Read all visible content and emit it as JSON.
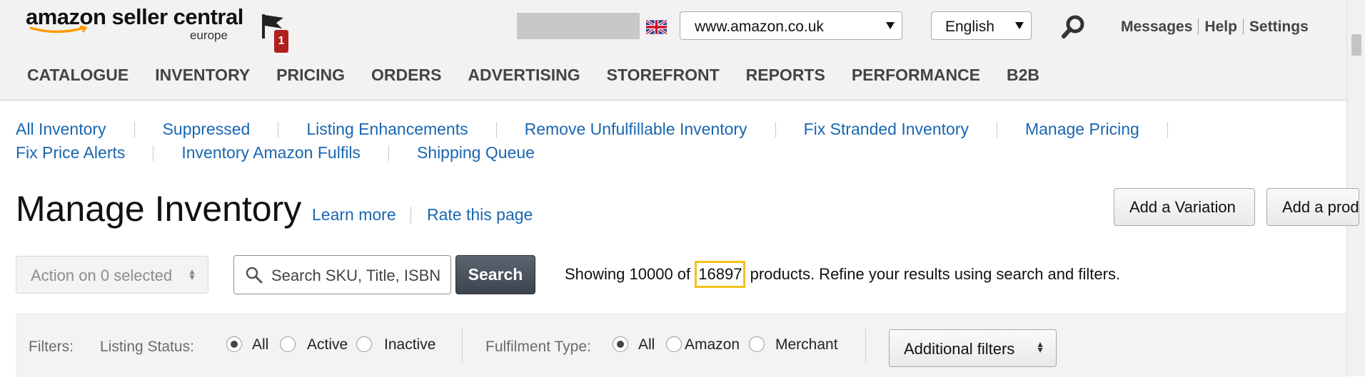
{
  "header": {
    "logo_brand": "amazon seller central",
    "logo_region": "europe",
    "alerts_count": "1",
    "marketplace": "www.amazon.co.uk",
    "language": "English",
    "links": [
      "Messages",
      "Help",
      "Settings"
    ]
  },
  "main_nav": [
    "CATALOGUE",
    "INVENTORY",
    "PRICING",
    "ORDERS",
    "ADVERTISING",
    "STOREFRONT",
    "REPORTS",
    "PERFORMANCE",
    "B2B"
  ],
  "sub_nav": {
    "row1": [
      "All Inventory",
      "Suppressed",
      "Listing Enhancements",
      "Remove Unfulfillable Inventory",
      "Fix Stranded Inventory",
      "Manage Pricing"
    ],
    "row2": [
      "Fix Price Alerts",
      "Inventory Amazon Fulfils",
      "Shipping Queue"
    ]
  },
  "page": {
    "title": "Manage Inventory",
    "learn_more": "Learn more",
    "rate_page": "Rate this page",
    "add_variation": "Add a Variation",
    "add_product": "Add a product"
  },
  "toolbar": {
    "action_label": "Action on 0 selected",
    "search_placeholder": "Search SKU, Title, ISBN",
    "search_button": "Search",
    "summary_prefix": "Showing 10000 of",
    "summary_count": "16897",
    "summary_suffix": "products. Refine your results using search and filters."
  },
  "filters": {
    "label": "Filters:",
    "listing_status_label": "Listing Status:",
    "listing_status_options": [
      "All",
      "Active",
      "Inactive"
    ],
    "listing_status_selected": "All",
    "fulfilment_type_label": "Fulfilment Type:",
    "fulfilment_type_options": [
      "All",
      "Amazon",
      "Merchant"
    ],
    "fulfilment_type_selected": "All",
    "additional_filters": "Additional filters"
  },
  "colors": {
    "link": "#1a66b0",
    "highlight": "#f2c21b",
    "badge": "#b01e1e",
    "search_button": "#3c434d"
  }
}
